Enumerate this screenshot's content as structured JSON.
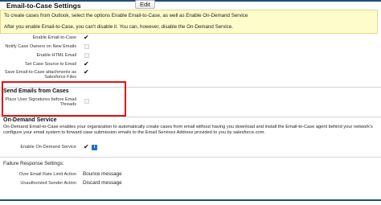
{
  "section": {
    "title": "Email-to-Case Settings",
    "edit_label": "Edit"
  },
  "info": {
    "line1": "To create cases from Outlook, select the options Enable Email-to-Case, as well as Enable On-Demand Service",
    "line2": "After you enable Email-to-Case, you can't disable it. You can, however, disable the On-Demand Service."
  },
  "settings": [
    {
      "label": "Enable Email-to-Case",
      "checked": true
    },
    {
      "label": "Notify Case Owners on New Emails",
      "checked": false
    },
    {
      "label": "Enable HTML Email",
      "checked": false
    },
    {
      "label": "Set Case Source to Email",
      "checked": true
    },
    {
      "label_line1": "Save Email-to-Case attachments as",
      "label_line2": "Salesforce Files",
      "checked": true
    }
  ],
  "send_emails": {
    "heading": "Send Emails from Cases",
    "option_line1": "Place User Signatures before Email",
    "option_line2": "Threads",
    "checked": false
  },
  "on_demand": {
    "heading": "On-Demand Service",
    "desc_line1": "On-Demand Email-to-Case enables your organization to automatically create cases from email without having you download and install the Email-to-Case agent behind your network's",
    "desc_line2": "configure your email system to forward case submission emails to the Email Services Address provided to you by salesforce.com.",
    "enable_label": "Enable On-Demand Service",
    "enabled": true,
    "info_glyph": "i"
  },
  "failure": {
    "heading": "Failure Response Settings:",
    "rows": [
      {
        "label": "Over Email Rate Limit Action",
        "value": "Bounce message"
      },
      {
        "label": "Unauthorized Sender Action",
        "value": "Discard message"
      }
    ]
  },
  "icons": {
    "checkmark": "check-icon",
    "info": "info-icon"
  },
  "colors": {
    "highlight": "#e01414",
    "info_background": "#fffccc",
    "accent": "#1f4e79"
  }
}
